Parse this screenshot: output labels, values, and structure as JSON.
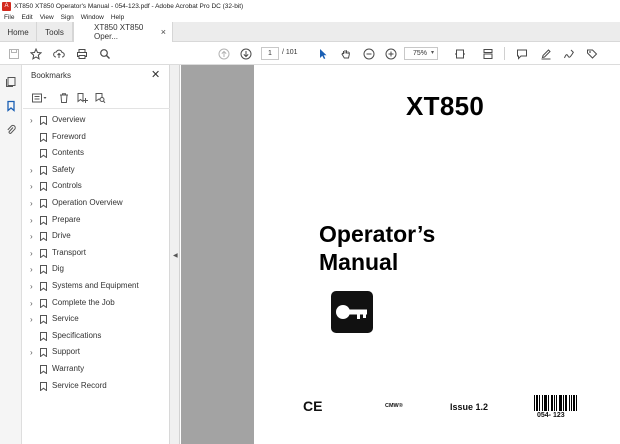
{
  "window": {
    "title": "XT850 XT850 Operator's Manual - 054-123.pdf - Adobe Acrobat Pro DC (32-bit)",
    "app_icon": "acrobat-icon",
    "app_icon_glyph": "A"
  },
  "menu": [
    "File",
    "Edit",
    "View",
    "Sign",
    "Window",
    "Help"
  ],
  "tabs": {
    "home": "Home",
    "tools": "Tools",
    "doc": "XT850 XT850 Oper...",
    "doc_close": "×"
  },
  "toolbar": {
    "page_current": "1",
    "page_total": "/ 101",
    "zoom": "75%",
    "zoom_caret": "▾"
  },
  "bookmarks": {
    "title": "Bookmarks",
    "close": "✕",
    "items": [
      {
        "label": "Overview",
        "expandable": true
      },
      {
        "label": "Foreword",
        "expandable": false
      },
      {
        "label": "Contents",
        "expandable": false
      },
      {
        "label": "Safety",
        "expandable": true
      },
      {
        "label": "Controls",
        "expandable": true
      },
      {
        "label": "Operation Overview",
        "expandable": true
      },
      {
        "label": "Prepare",
        "expandable": true
      },
      {
        "label": "Drive",
        "expandable": true
      },
      {
        "label": "Transport",
        "expandable": true
      },
      {
        "label": "Dig",
        "expandable": true
      },
      {
        "label": "Systems and Equipment",
        "expandable": true
      },
      {
        "label": "Complete the Job",
        "expandable": true
      },
      {
        "label": "Service",
        "expandable": true
      },
      {
        "label": "Specifications",
        "expandable": false
      },
      {
        "label": "Support",
        "expandable": true
      },
      {
        "label": "Warranty",
        "expandable": false
      },
      {
        "label": "Service Record",
        "expandable": false
      }
    ]
  },
  "pdf": {
    "model": "XT850",
    "heading_line1": "Operator’s",
    "heading_line2": "Manual",
    "ce_mark": "CE",
    "cmw": "CMW®",
    "issue": "Issue 1.2",
    "part_number": "054- 123"
  },
  "colors": {
    "accent": "#1a5fb4",
    "doc_background": "#a3a3a3",
    "acrobat_red": "#d32a1e"
  }
}
